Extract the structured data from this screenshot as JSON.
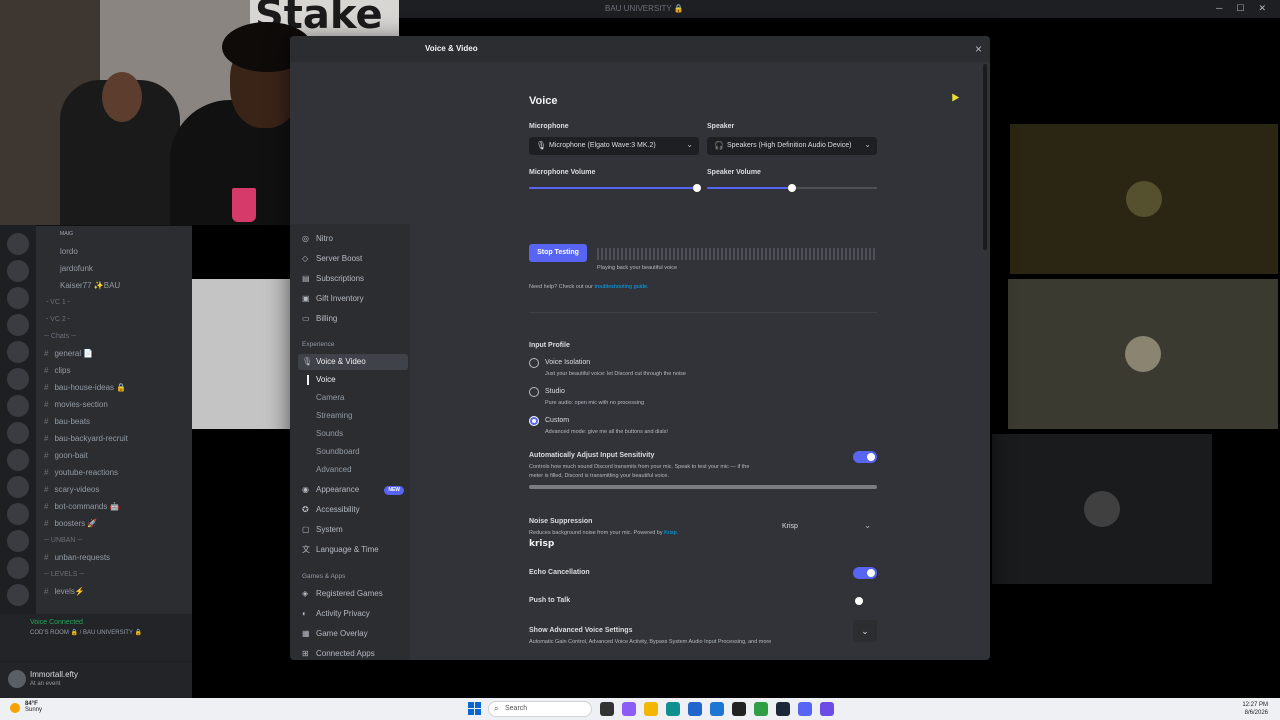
{
  "window": {
    "title": "BAU UNIVERSITY 🔒"
  },
  "webcam": {
    "sign_text": "Stake"
  },
  "channels": [
    {
      "type": "voice_user",
      "name": "ᴹᴬᴵᴳ"
    },
    {
      "type": "voice_user",
      "name": "lordo"
    },
    {
      "type": "voice_user",
      "name": "jardofunk"
    },
    {
      "type": "voice_user",
      "name": "Kaiser77 ✨BAU"
    },
    {
      "type": "cat",
      "name": "╶ VC 1 ╴"
    },
    {
      "type": "cat",
      "name": "╶ VC 2 ╴"
    },
    {
      "type": "cat",
      "name": "─ Chats ─"
    },
    {
      "type": "text",
      "name": "general 📄"
    },
    {
      "type": "text",
      "name": "clips"
    },
    {
      "type": "text",
      "name": "bau-house-ideas 🔒"
    },
    {
      "type": "text",
      "name": "movies-section"
    },
    {
      "type": "text",
      "name": "bau-beats"
    },
    {
      "type": "text",
      "name": "bau-backyard-recruit"
    },
    {
      "type": "text",
      "name": "goon-bait"
    },
    {
      "type": "text",
      "name": "youtube-reactions"
    },
    {
      "type": "text",
      "name": "scary-videos"
    },
    {
      "type": "text",
      "name": "bot-commands 🤖"
    },
    {
      "type": "text",
      "name": "boosters 🚀"
    },
    {
      "type": "cat",
      "name": "─ UNBAN ─"
    },
    {
      "type": "text",
      "name": "unban-requests"
    },
    {
      "type": "cat",
      "name": "─ LEVELS ─"
    },
    {
      "type": "text",
      "name": "levels⚡"
    }
  ],
  "voice_connected": {
    "title": "Voice Connected",
    "subtitle": "COD'S ROOM 🔒 / BAU UNIVERSITY 🔒"
  },
  "user": {
    "name": "Immortall.efty",
    "status": "At an event"
  },
  "modal": {
    "header_title": "Voice & Video",
    "close_icon": "×",
    "nav": {
      "items_top": [
        "Nitro",
        "Server Boost",
        "Subscriptions",
        "Gift Inventory",
        "Billing"
      ],
      "cat_experience": "Experience",
      "voice_video": "Voice & Video",
      "sub_items": [
        "Voice",
        "Camera",
        "Streaming",
        "Sounds",
        "Soundboard",
        "Advanced"
      ],
      "items_mid": [
        "Appearance",
        "Accessibility",
        "System",
        "Language & Time"
      ],
      "new_badge": "NEW",
      "cat_games": "Games & Apps",
      "items_games": [
        "Registered Games",
        "Activity Privacy",
        "Game Overlay",
        "Connected Apps"
      ]
    },
    "voice": {
      "title": "Voice",
      "mic_label": "Microphone",
      "mic_value": "Microphone (Elgato Wave:3 MK.2)",
      "speaker_label": "Speaker",
      "speaker_value": "Speakers (High Definition Audio Device)",
      "mic_volume_label": "Microphone Volume",
      "mic_volume": 0.99,
      "speaker_volume_label": "Speaker Volume",
      "speaker_volume": 0.5,
      "stop_testing": "Stop Testing",
      "playback_text": "Playing back your beautiful voice",
      "help_text": "Need help? Check out our ",
      "help_link": "troubleshooting guide."
    },
    "input_profile": {
      "title": "Input Profile",
      "options": [
        {
          "title": "Voice Isolation",
          "desc": "Just your beautiful voice: let Discord cut through the noise",
          "selected": false
        },
        {
          "title": "Studio",
          "desc": "Pure audio: open mic with no processing",
          "selected": false
        },
        {
          "title": "Custom",
          "desc": "Advanced mode: give me all the buttons and dials!",
          "selected": true
        }
      ]
    },
    "auto_sensitivity": {
      "title": "Automatically Adjust Input Sensitivity",
      "desc1": "Controls how much sound Discord transmits from your mic. Speak to test your mic — if the",
      "desc2": "meter is filled, Discord is transmitting your beautiful voice.",
      "enabled": true
    },
    "noise": {
      "title": "Noise Suppression",
      "desc": "Reduces background noise from your mic. Powered by ",
      "desc_link": "Krisp.",
      "logo": "krisp",
      "value": "Krisp"
    },
    "echo": {
      "title": "Echo Cancellation",
      "enabled": true
    },
    "ptt": {
      "title": "Push to Talk",
      "enabled": false
    },
    "advanced": {
      "title": "Show Advanced Voice Settings",
      "desc": "Automatic Gain Control, Advanced Voice Activity, Bypass System Audio Input Processing, and more"
    }
  },
  "taskbar": {
    "temp": "84°F",
    "weather": "Sunny",
    "search_placeholder": "Search",
    "time": "12:27 PM",
    "date": "8/6/2026"
  }
}
